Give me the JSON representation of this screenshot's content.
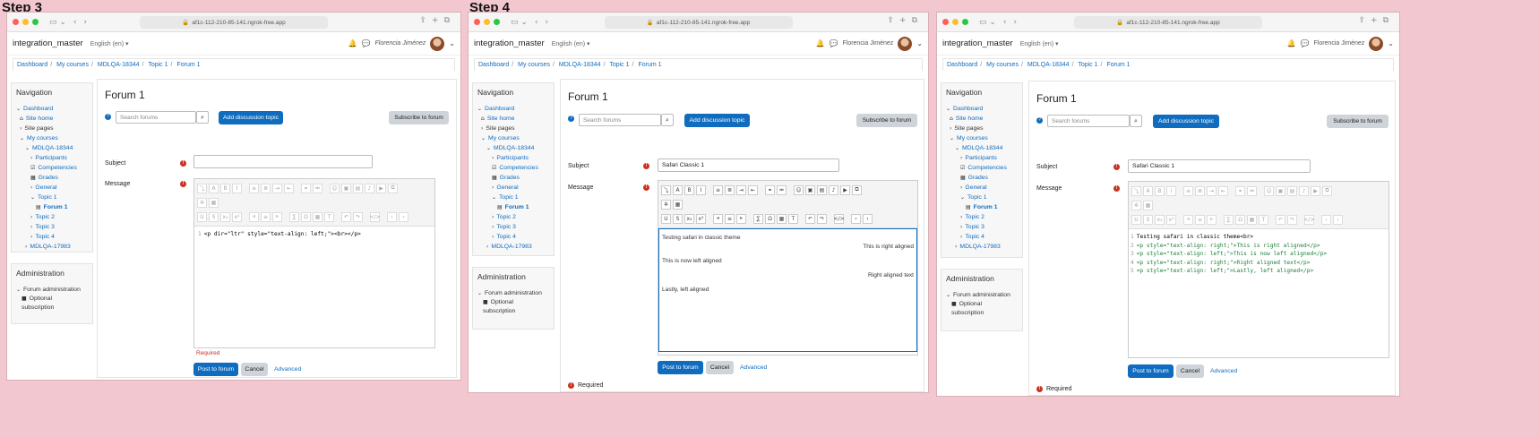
{
  "steps": [
    {
      "label": "Step 3",
      "url": "af1c-112-210-85-141.ngrok-free.app",
      "site_name": "integration_master",
      "language": "English (en) ▾",
      "user_name": "Florencia Jiménez",
      "breadcrumb": [
        "Dashboard",
        "My courses",
        "MDLQA-18344",
        "Topic 1",
        "Forum 1"
      ],
      "nav_title": "Navigation",
      "nav_items": [
        "Dashboard",
        "Site home",
        "Site pages",
        "My courses",
        "MDLQA-18344",
        "Participants",
        "Competencies",
        "Grades",
        "General",
        "Topic 1",
        "Forum 1",
        "Topic 2",
        "Topic 3",
        "Topic 4",
        "MDLQA-17983"
      ],
      "admin_title": "Administration",
      "admin_items": [
        "Forum administration",
        "Optional subscription"
      ],
      "forum_title": "Forum 1",
      "search_placeholder": "Search forums",
      "add_topic": "Add discussion topic",
      "subscribe": "Subscribe to forum",
      "subject_label": "Subject",
      "subject_value": "",
      "message_label": "Message",
      "code_lines": [
        "<p dir=\"ltr\" style=\"text-align: left;\"><br></p>"
      ],
      "required": "Required",
      "post_button": "Post to forum",
      "cancel_button": "Cancel",
      "advanced_link": "Advanced"
    },
    {
      "label": "Step 4",
      "url": "af1c-112-210-85-141.ngrok-free.app",
      "site_name": "integration_master",
      "language": "English (en) ▾",
      "user_name": "Florencia Jiménez",
      "breadcrumb": [
        "Dashboard",
        "My courses",
        "MDLQA-18344",
        "Topic 1",
        "Forum 1"
      ],
      "nav_title": "Navigation",
      "nav_items": [
        "Dashboard",
        "Site home",
        "Site pages",
        "My courses",
        "MDLQA-18344",
        "Participants",
        "Competencies",
        "Grades",
        "General",
        "Topic 1",
        "Forum 1",
        "Topic 2",
        "Topic 3",
        "Topic 4",
        "MDLQA-17983"
      ],
      "admin_title": "Administration",
      "admin_items": [
        "Forum administration",
        "Optional subscription"
      ],
      "forum_title": "Forum 1",
      "search_placeholder": "Search forums",
      "add_topic": "Add discussion topic",
      "subscribe": "Subscribe to forum",
      "subject_label": "Subject",
      "subject_value": "Safari Classic 1",
      "message_label": "Message",
      "wysiwyg": [
        {
          "text": "Testing safari in classic theme",
          "align": "left"
        },
        {
          "text": "This is right aligned",
          "align": "right"
        },
        {
          "text": "This is now left aligned",
          "align": "left"
        },
        {
          "text": "Right aligned text",
          "align": "right"
        },
        {
          "text": "Lastly, left aligned",
          "align": "left"
        }
      ],
      "required": "Required",
      "post_button": "Post to forum",
      "cancel_button": "Cancel",
      "advanced_link": "Advanced"
    },
    {
      "label": "",
      "url": "af1c-112-210-85-141.ngrok-free.app",
      "site_name": "integration_master",
      "language": "English (en) ▾",
      "user_name": "Florencia Jiménez",
      "breadcrumb": [
        "Dashboard",
        "My courses",
        "MDLQA-18344",
        "Topic 1",
        "Forum 1"
      ],
      "nav_title": "Navigation",
      "nav_items": [
        "Dashboard",
        "Site home",
        "Site pages",
        "My courses",
        "MDLQA-18344",
        "Participants",
        "Competencies",
        "Grades",
        "General",
        "Topic 1",
        "Forum 1",
        "Topic 2",
        "Topic 3",
        "Topic 4",
        "MDLQA-17983"
      ],
      "admin_title": "Administration",
      "admin_items": [
        "Forum administration",
        "Optional subscription"
      ],
      "forum_title": "Forum 1",
      "search_placeholder": "Search forums",
      "add_topic": "Add discussion topic",
      "subscribe": "Subscribe to forum",
      "subject_label": "Subject",
      "subject_value": "Safari Classic 1",
      "message_label": "Message",
      "code_lines": [
        "Testing safari in classic theme<br>",
        "<p style=\"text-align: right;\">This is right aligned</p>",
        "<p style=\"text-align: left;\">This is now left aligned</p>",
        "<p style=\"text-align: right;\">Right aligned text</p>",
        "<p style=\"text-align: left;\">Lastly, left aligned</p>"
      ],
      "required": "Required",
      "post_button": "Post to forum",
      "cancel_button": "Cancel",
      "advanced_link": "Advanced"
    }
  ]
}
